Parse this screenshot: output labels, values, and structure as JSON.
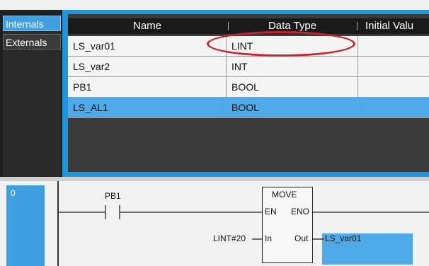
{
  "variable_table": {
    "tabs": [
      {
        "label": "Internals",
        "active": true
      },
      {
        "label": "Externals",
        "active": false
      }
    ],
    "columns": [
      "Name",
      "Data Type",
      "Initial Valu"
    ],
    "rows": [
      {
        "name": "LS_var01",
        "data_type": "LINT",
        "initial_value": "",
        "selected": false
      },
      {
        "name": "LS_var2",
        "data_type": "INT",
        "initial_value": "",
        "selected": false
      },
      {
        "name": "PB1",
        "data_type": "BOOL",
        "initial_value": "",
        "selected": false
      },
      {
        "name": "LS_AL1",
        "data_type": "BOOL",
        "initial_value": "",
        "selected": true
      }
    ],
    "annotation_color": "#d0202a"
  },
  "ladder": {
    "rung_number": "0",
    "contact_label": "PB1",
    "function_block": {
      "title": "MOVE",
      "en": "EN",
      "eno": "ENO",
      "in": "In",
      "out": "Out"
    },
    "in_operand": "LINT#20",
    "out_operand": "LS_var01"
  },
  "colors": {
    "selection_blue": "#4fa9e8",
    "frame_blue": "#2196dc",
    "dark_bg": "#1f1f1f"
  }
}
